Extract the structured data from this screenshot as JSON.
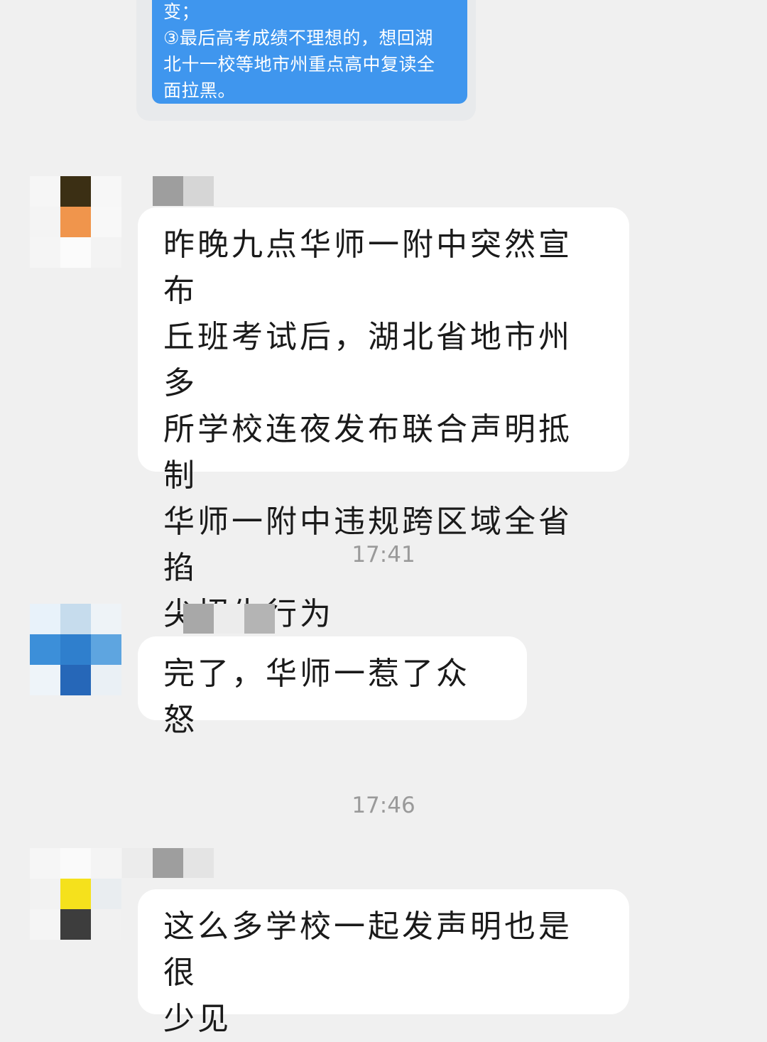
{
  "quoted_card": {
    "lines": [
      "变；",
      "③最后高考成绩不理想的，想回湖",
      "北十一校等地市州重点高中复读全",
      "面拉黑。"
    ]
  },
  "messages": [
    {
      "text": "昨晚九点华师一附中突然宣布\n丘班考试后，湖北省地市州多\n所学校连夜发布联合声明抵制\n华师一附中违规跨区域全省掐\n尖招生行为"
    },
    {
      "text": "完了，华师一惹了众怒"
    },
    {
      "text": "这么多学校一起发声明也是很\n少见"
    }
  ],
  "timestamps": [
    "17:41",
    "17:46"
  ],
  "colors": {
    "background": "#f0f0f0",
    "bubble": "#ffffff",
    "quote_card": "#3f96ee",
    "timestamp_text": "#9a9a9a"
  }
}
